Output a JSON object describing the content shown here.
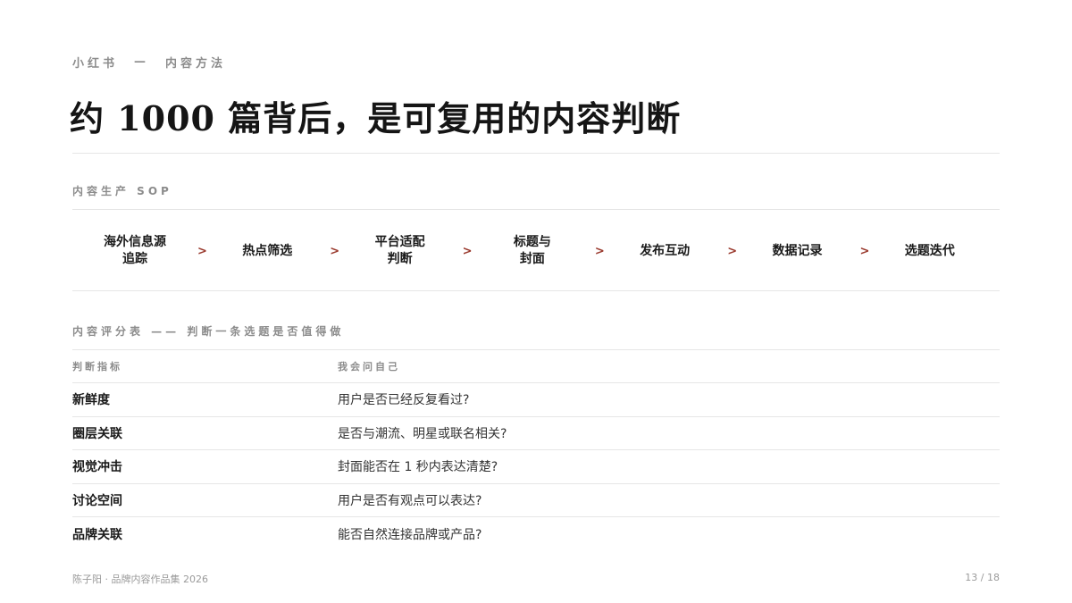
{
  "header": {
    "brand": "小红书",
    "separator": "—",
    "section": "内容方法"
  },
  "title": "约 1000 篇背后，是可复用的内容判断",
  "sop": {
    "label": "内容生产 SOP",
    "separator": ">",
    "steps": [
      "海外信息源\n追踪",
      "热点筛选",
      "平台适配\n判断",
      "标题与\n封面",
      "发布互动",
      "数据记录",
      "选题迭代"
    ]
  },
  "scorecard": {
    "label": "内容评分表 —— 判断一条选题是否值得做",
    "headers": [
      "判断指标",
      "我会问自己"
    ],
    "rows": [
      {
        "metric": "新鲜度",
        "question": "用户是否已经反复看过?"
      },
      {
        "metric": "圈层关联",
        "question": "是否与潮流、明星或联名相关?"
      },
      {
        "metric": "视觉冲击",
        "question": "封面能否在 1 秒内表达清楚?"
      },
      {
        "metric": "讨论空间",
        "question": "用户是否有观点可以表达?"
      },
      {
        "metric": "品牌关联",
        "question": "能否自然连接品牌或产品?"
      }
    ]
  },
  "footer": {
    "left": "陈子阳 · 品牌内容作品集 2026",
    "page": "13 / 18"
  },
  "colors": {
    "accent": "#9a3a2e",
    "muted": "#8c8c8c",
    "rule": "#e6e6e6"
  }
}
